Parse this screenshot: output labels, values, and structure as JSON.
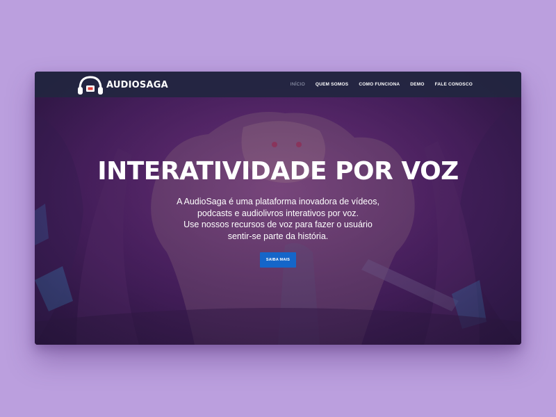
{
  "brand": {
    "name": "AUDIOSAGA",
    "logo_icon": "headphones-icon"
  },
  "nav": {
    "items": [
      {
        "label": "INÍCIO",
        "active": true
      },
      {
        "label": "QUEM SOMOS",
        "active": false
      },
      {
        "label": "COMO FUNCIONA",
        "active": false
      },
      {
        "label": "DEMO",
        "active": false
      },
      {
        "label": "FALE CONOSCO",
        "active": false
      }
    ]
  },
  "hero": {
    "title": "INTERATIVIDADE POR VOZ",
    "description_lines": [
      "A AudioSaga é uma plataforma inovadora de vídeos,",
      "podcasts e audiolivros interativos por voz.",
      "Use nossos recursos de voz para fazer o usuário",
      "sentir-se parte da história."
    ],
    "cta_label": "SAIBA MAIS"
  },
  "colors": {
    "page_background": "#bb9fde",
    "navbar": "#222640",
    "cta": "#1566c9",
    "text": "#ffffff"
  }
}
